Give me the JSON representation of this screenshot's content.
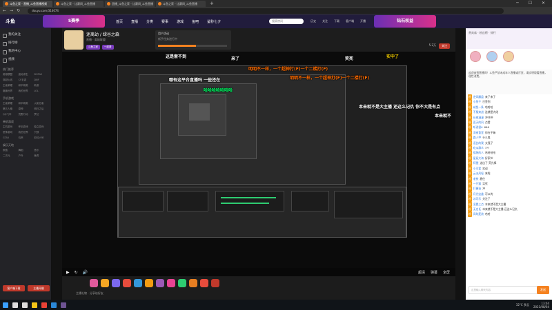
{
  "browser": {
    "tabs": [
      "斗鱼之家 - 直播_斗鱼直播视频",
      "斗鱼之家 - 比赛间_斗鱼直播",
      "团播_斗鱼之家 - 比赛间_斗鱼直播",
      "斗鱼之家 - 比赛间_斗鱼直播"
    ],
    "url": "douyu.com/314074"
  },
  "site": {
    "logo": "斗鱼",
    "banner_text": "S赛季",
    "nav": [
      "首页",
      "直播",
      "分类",
      "赛事",
      "游戏",
      "鱼吧",
      "鲨秒七夕"
    ],
    "search_placeholder": "搜索房间",
    "top_icons": [
      "历史",
      "关注",
      "下载",
      "客户端",
      "开播"
    ],
    "banner2_text": "钻石权益"
  },
  "leftnav": {
    "items": [
      "我的关注",
      "排行榜",
      "我的中心",
      "视频"
    ],
    "sections": [
      {
        "title": "热门推荐",
        "items": [
          "英雄联盟",
          "绝地求生",
          "DOTA2",
          "穿越火线",
          "CF手游",
          "DNF",
          "王者荣耀",
          "和平精英",
          "新游",
          "魔兽世界",
          "我的世界",
          "LOL"
        ]
      },
      {
        "title": "手机游戏",
        "items": [
          "王者荣耀",
          "和平精英",
          "火影忍者",
          "第五人格",
          "原神",
          "明日之后",
          "QQ飞车",
          "荒野行动",
          "梦幻"
        ]
      },
      {
        "title": "单机游戏",
        "items": [
          "主机游戏",
          "怀旧游戏",
          "独立游戏",
          "恐怖游戏",
          "我的世界",
          "只狼",
          "GTA5",
          "饥荒",
          "彩虹六号"
        ]
      },
      {
        "title": "娱乐天地",
        "items": [
          "颜值",
          "舞蹈",
          "音乐",
          "二次元",
          "户外",
          "鱼秀"
        ]
      }
    ],
    "btn_left": "客户端下载",
    "btn_right": "主播开播"
  },
  "room": {
    "title": "迷离幼 / 绿谷之森",
    "subtitle": "直播 · 英雄联盟",
    "tags": [
      "斗鱼之家",
      "一起看"
    ],
    "activity_title": "用户活动",
    "activity_sub": "新手任务进行中",
    "activity_progress": 0.55,
    "follow_btn": "关注",
    "follow_count": "5.2万"
  },
  "video": {
    "danmu": [
      {
        "text": "这是套不到",
        "color": "#ffffff"
      },
      {
        "text": "来了",
        "color": "#ffffff"
      },
      {
        "text": "笑死",
        "color": "#ffffff"
      },
      {
        "text": "实中了",
        "color": "#ffd700"
      },
      {
        "text": "明明不一样，一个超神打(F)一个二楼打(F)",
        "color": "#ff6b00"
      },
      {
        "text": "哪有这平台直播吗 一些还在",
        "color": "#ffffff"
      },
      {
        "text": "明明不一样，一个超神打(F)一个二楼打(F)",
        "color": "#ff6b00"
      },
      {
        "text": "哈哈哈哈哈哈哈",
        "color": "#00ff66"
      },
      {
        "text": "本来就不是大主播 还这么记仇 你不大是有点",
        "color": "#ffffff"
      },
      {
        "text": "本来就不",
        "color": "#ffffff"
      }
    ],
    "controls": {
      "play": "▶",
      "refresh": "↻",
      "volume": "🔊",
      "right": [
        "超清",
        "弹幕",
        "全屏"
      ]
    }
  },
  "gifts": {
    "label": "主播礼物 · 分享给好友",
    "colors": [
      "#e05a9c",
      "#f5a623",
      "#7b68ee",
      "#e74c3c",
      "#3498db",
      "#f39c12",
      "#9b59b6",
      "#e84393",
      "#2ecc71",
      "#e67e22",
      "#e74c3c",
      "#c0392b"
    ]
  },
  "chat": {
    "header": "贵宾席 · 粉丝榜 · 排行",
    "notice": "欢迎来到直播间！斗鱼严禁未成年人直播或打赏，请文明观看直播，理性消费。",
    "lines": [
      {
        "nick": "逆风翻盘",
        "text": "来了来了"
      },
      {
        "nick": "小鱼干",
        "text": "已签到"
      },
      {
        "nick": "咸鱼一条",
        "text": "哈哈哈"
      },
      {
        "nick": "不服来战",
        "text": "这就是大佬"
      },
      {
        "nick": "长夜漫漫",
        "text": "冲冲冲"
      },
      {
        "nick": "夏天的风",
        "text": "点赞"
      },
      {
        "nick": "听说很6",
        "text": "666"
      },
      {
        "nick": "深夜食堂",
        "text": "你在干嘛"
      },
      {
        "nick": "路人甲",
        "text": "什么鬼"
      },
      {
        "nick": "逗比的我",
        "text": "太强了"
      },
      {
        "nick": "吃瓜群众",
        "text": "???"
      },
      {
        "nick": "孤独的人",
        "text": "哈哈哈哈"
      },
      {
        "nick": "星辰大海",
        "text": "好家伙"
      },
      {
        "nick": "阿狸",
        "text": "送出了 荧光棒"
      },
      {
        "nick": "小可爱",
        "text": "欢迎"
      },
      {
        "nick": "云淡风轻",
        "text": "来啦"
      },
      {
        "nick": "老铁",
        "text": "稳住"
      },
      {
        "nick": "一只猫",
        "text": "笑死"
      },
      {
        "nick": "打酱油",
        "text": "冲"
      },
      {
        "nick": "月光宝盒",
        "text": "可以的"
      },
      {
        "nick": "冰可乐",
        "text": "关注了"
      },
      {
        "nick": "凌晨三点",
        "text": "本来就不是大主播"
      },
      {
        "nick": "无名氏",
        "text": "本来就不是大主播 还这么记仇"
      },
      {
        "nick": "风吹麦浪",
        "text": "哈哈"
      }
    ],
    "input_placeholder": "这里输入聊天内容",
    "send_label": "发送"
  },
  "taskbar": {
    "icons": [
      "start-icon",
      "search-icon",
      "taskview-icon",
      "folder-icon",
      "chrome-icon",
      "store-icon",
      "obs-icon"
    ],
    "weather": "32°C 多云",
    "time": "13:04",
    "date": "2021/08/04"
  }
}
